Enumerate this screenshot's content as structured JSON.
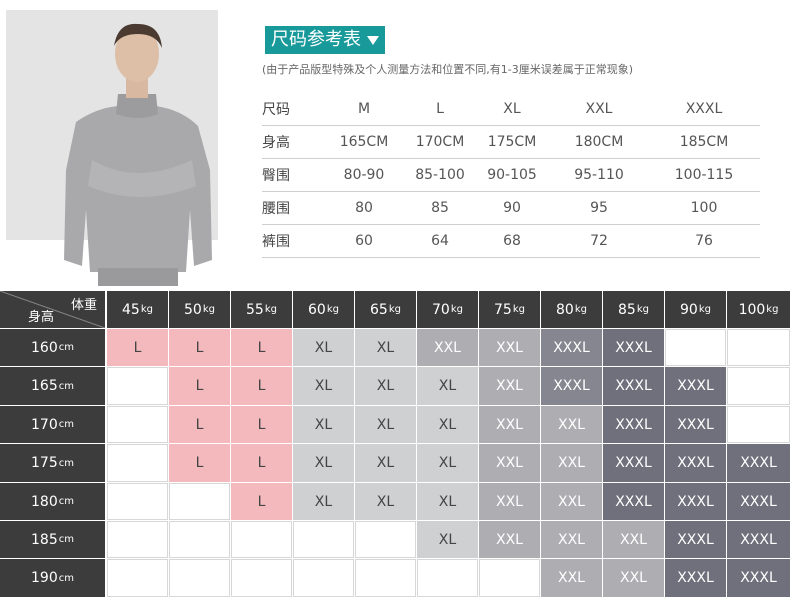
{
  "title": "尺码参考表",
  "note": "(由于产品版型特殊及个人测量方法和位置不同,有1-3厘米误差属于正常现象)",
  "size_table": {
    "header": {
      "label": "尺码",
      "values": [
        "M",
        "L",
        "XL",
        "XXL",
        "XXXL"
      ]
    },
    "rows": [
      {
        "label": "身高",
        "values": [
          "165CM",
          "170CM",
          "175CM",
          "180CM",
          "185CM"
        ]
      },
      {
        "label": "臀围",
        "values": [
          "80-90",
          "85-100",
          "90-105",
          "95-110",
          "100-115"
        ]
      },
      {
        "label": "腰围",
        "values": [
          "80",
          "85",
          "90",
          "95",
          "100"
        ]
      },
      {
        "label": "裤围",
        "values": [
          "60",
          "64",
          "68",
          "72",
          "76"
        ]
      }
    ]
  },
  "grid": {
    "corner_top": "体重",
    "corner_bottom": "身高",
    "weights": [
      "45",
      "50",
      "55",
      "60",
      "65",
      "70",
      "75",
      "80",
      "85",
      "90",
      "100"
    ],
    "weight_unit": "kg",
    "heights": [
      "160",
      "165",
      "170",
      "175",
      "180",
      "185",
      "190"
    ],
    "height_unit": "cm",
    "cells": [
      [
        "L",
        "L",
        "L",
        "XL",
        "XL",
        "XXL",
        "XXL",
        "XXXL",
        "XXXL",
        "",
        ""
      ],
      [
        "",
        "L",
        "L",
        "XL",
        "XL",
        "XL",
        "XXL",
        "XXXL",
        "XXXL",
        "XXXL",
        ""
      ],
      [
        "",
        "L",
        "L",
        "XL",
        "XL",
        "XL",
        "XXL",
        "XXL",
        "XXXL",
        "XXXL",
        ""
      ],
      [
        "",
        "L",
        "L",
        "XL",
        "XL",
        "XL",
        "XXL",
        "XXL",
        "XXXL",
        "XXXL",
        "XXXL"
      ],
      [
        "",
        "",
        "L",
        "XL",
        "XL",
        "XL",
        "XXL",
        "XXL",
        "XXXL",
        "XXXL",
        "XXXL"
      ],
      [
        "",
        "",
        "",
        "",
        "",
        "XL",
        "XXL",
        "XXL",
        "XXL",
        "XXXL",
        "XXXL"
      ],
      [
        "",
        "",
        "",
        "",
        "",
        "",
        "",
        "XXL",
        "XXL",
        "XXXL",
        "XXXL"
      ]
    ],
    "colors": {
      "L": "#f4b9bd",
      "XL": "#cfd0d2",
      "XXL": "#aeaeb2",
      "XXXL": "#6f707c",
      "header": "#3c3c3c"
    }
  }
}
